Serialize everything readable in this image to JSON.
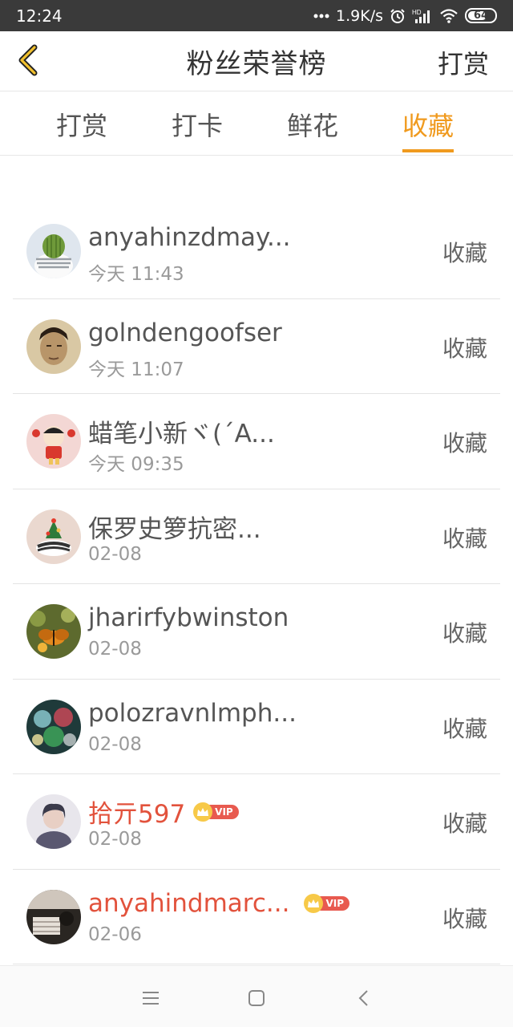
{
  "status_bar": {
    "time": "12:24",
    "net_speed": "1.9K/s",
    "network_label": "HD",
    "battery": "64",
    "icons": [
      "dots-icon",
      "alarm-icon",
      "signal-icon",
      "wifi-icon",
      "battery-icon"
    ]
  },
  "header": {
    "title": "粉丝荣誉榜",
    "action_label": "打赏",
    "back_icon": "chevron-left-icon"
  },
  "tabs": [
    {
      "label": "打赏",
      "active": false
    },
    {
      "label": "打卡",
      "active": false
    },
    {
      "label": "鲜花",
      "active": false
    },
    {
      "label": "收藏",
      "active": true
    }
  ],
  "colors": {
    "accent": "#f09a1e",
    "vip_name": "#e2523c",
    "status_bar": "#3a3a3a"
  },
  "fans": [
    {
      "name": "anyahinzdmay...",
      "time": "今天 11:43",
      "action": "收藏",
      "vip": false
    },
    {
      "name": "golndengoofser",
      "time": "今天 11:07",
      "action": "收藏",
      "vip": false
    },
    {
      "name": "蜡笔小新ヾ(´A...",
      "time": "今天 09:35",
      "action": "收藏",
      "vip": false
    },
    {
      "name": "保罗史箩抗密...",
      "time": "02-08",
      "action": "收藏",
      "vip": false
    },
    {
      "name": "jharirfybwinston",
      "time": "02-08",
      "action": "收藏",
      "vip": false
    },
    {
      "name": "polozravnlmph...",
      "time": "02-08",
      "action": "收藏",
      "vip": false
    },
    {
      "name": "拾亓597",
      "time": "02-08",
      "action": "收藏",
      "vip": true,
      "badge": "VIP"
    },
    {
      "name": "anyahindmarc...",
      "time": "02-06",
      "action": "收藏",
      "vip": true,
      "badge": "VIP"
    }
  ],
  "navbar": {
    "icons": [
      "menu-icon",
      "home-square-icon",
      "back-arrow-icon"
    ]
  }
}
